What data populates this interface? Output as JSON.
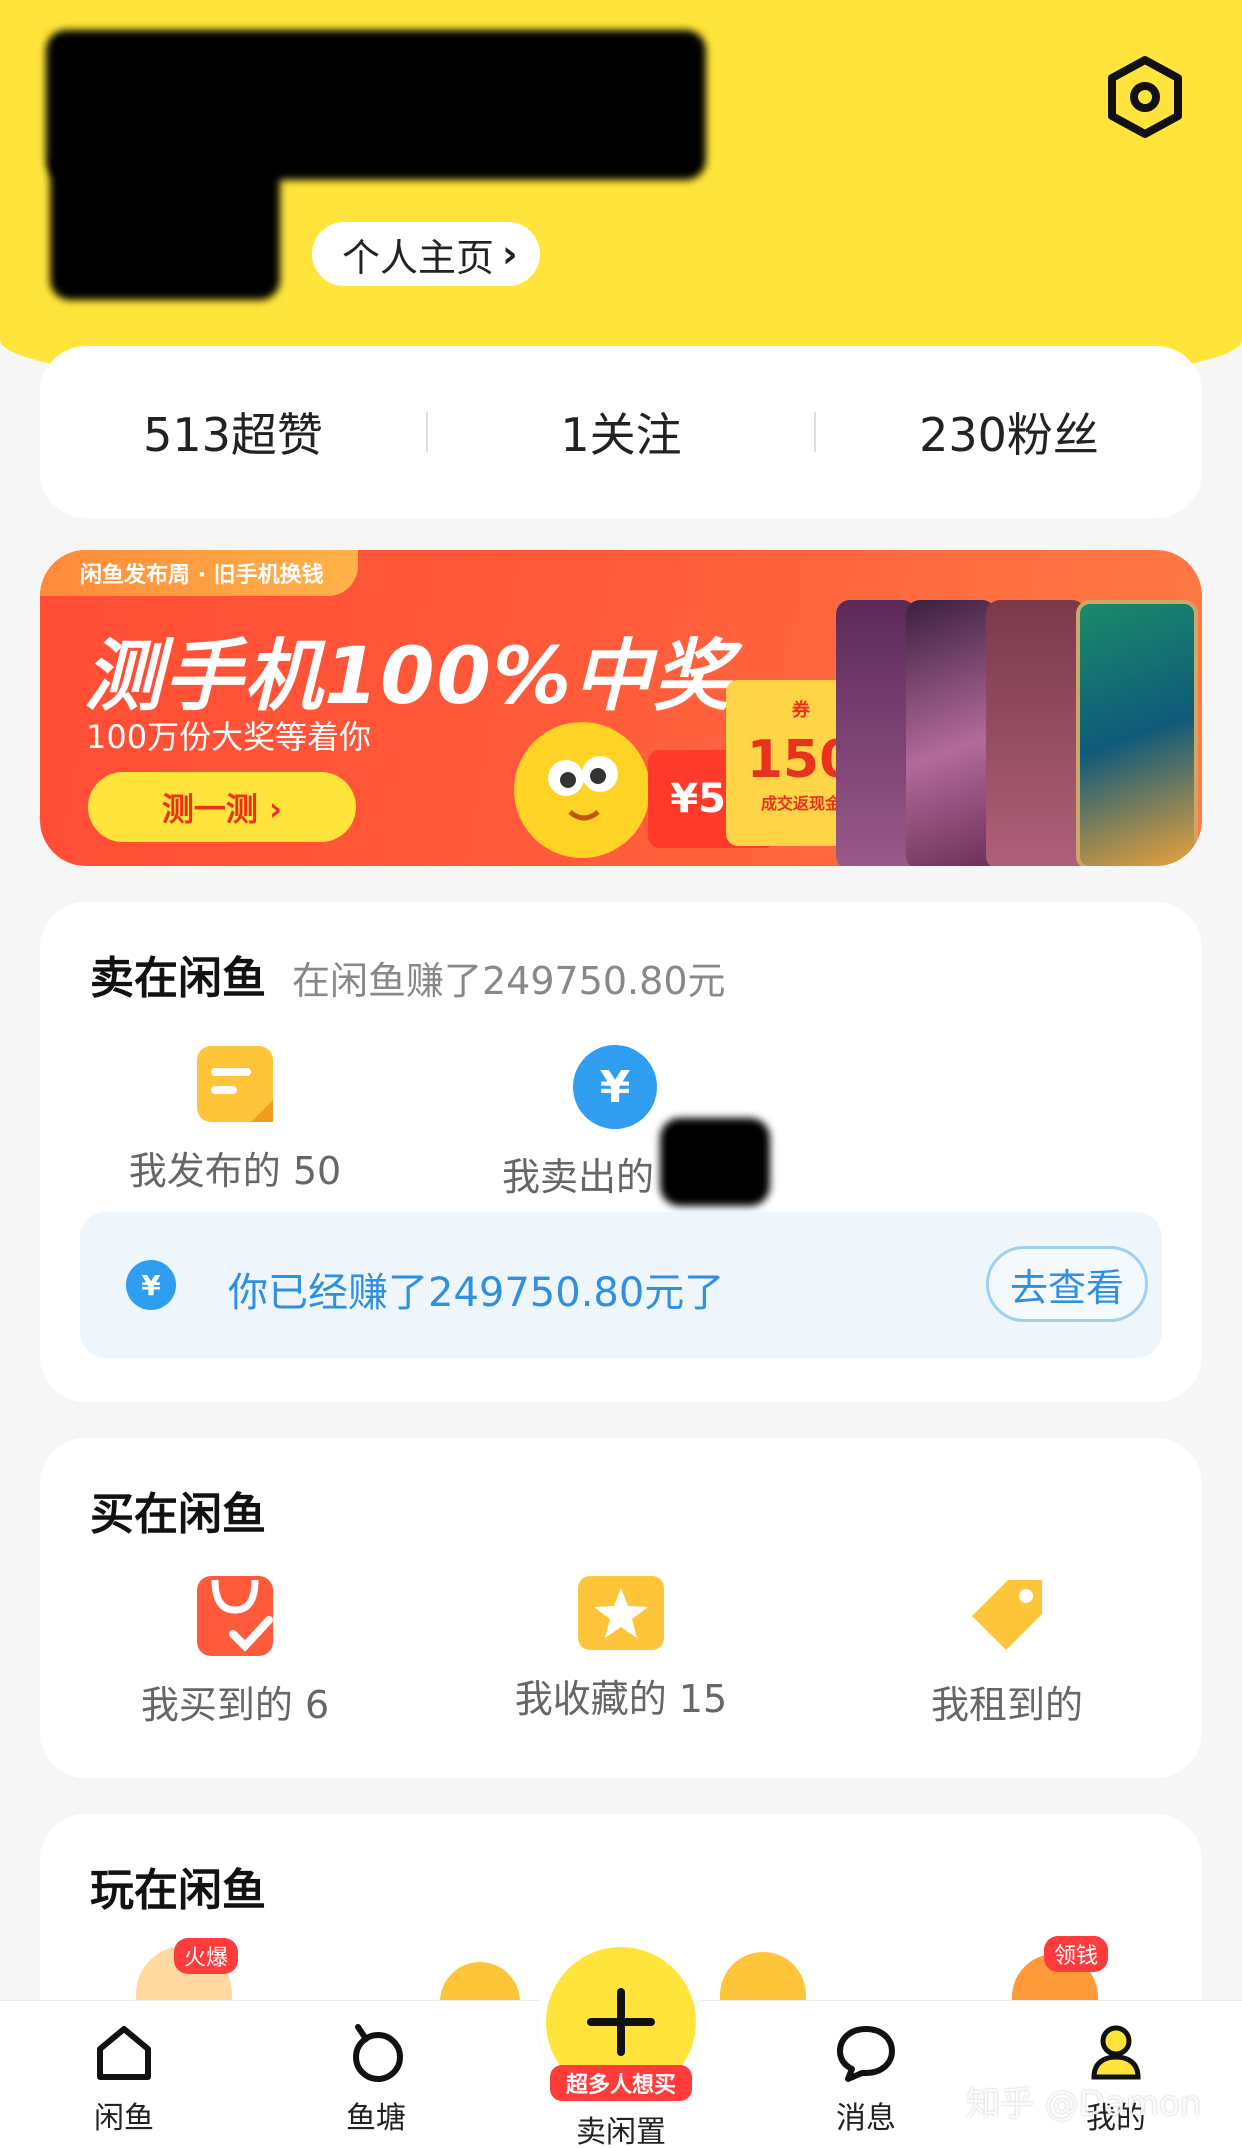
{
  "header": {
    "profile_link": "个人主页",
    "profile_chevron": "›"
  },
  "stats": [
    {
      "label": "513超赞"
    },
    {
      "label": "1关注"
    },
    {
      "label": "230粉丝"
    }
  ],
  "banner": {
    "tag": "闲鱼发布周 · 旧手机换钱",
    "title": "测手机100%中奖",
    "subtitle": "100万份大奖等着你",
    "button": "测一测 ›",
    "coupon_small": "¥50",
    "coupon_big": "150",
    "coupon_big_caption": "成交返现金",
    "coupon_big_tag": "券"
  },
  "sell": {
    "title": "卖在闲鱼",
    "subtitle": "在闲鱼赚了249750.80元",
    "items": [
      {
        "label": "我发布的 50",
        "icon": "post-icon"
      },
      {
        "label": "我卖出的",
        "icon": "yuan-coin-icon"
      }
    ],
    "earn": {
      "icon_text": "¥",
      "text": "你已经赚了249750.80元了",
      "button": "去查看"
    }
  },
  "buy": {
    "title": "买在闲鱼",
    "items": [
      {
        "label": "我买到的 6",
        "icon": "shopping-bag-icon"
      },
      {
        "label": "我收藏的 15",
        "icon": "star-folder-icon"
      },
      {
        "label": "我租到的",
        "icon": "tag-icon"
      }
    ]
  },
  "play": {
    "title": "玩在闲鱼",
    "badges": {
      "hot": "火爆",
      "money": "领钱"
    }
  },
  "tabbar": {
    "tabs": [
      {
        "label": "闲鱼",
        "icon": "home-icon"
      },
      {
        "label": "鱼塘",
        "icon": "pond-icon"
      },
      {
        "label": "消息",
        "icon": "message-icon"
      },
      {
        "label": "我的",
        "icon": "profile-icon"
      }
    ],
    "publish": {
      "badge": "超多人想买",
      "label": "卖闲置"
    }
  },
  "watermark": "知乎 @Damon",
  "colors": {
    "brand_yellow": "#ffe53b",
    "banner_red": "#ff4d35",
    "link_blue": "#2f8fe0"
  }
}
